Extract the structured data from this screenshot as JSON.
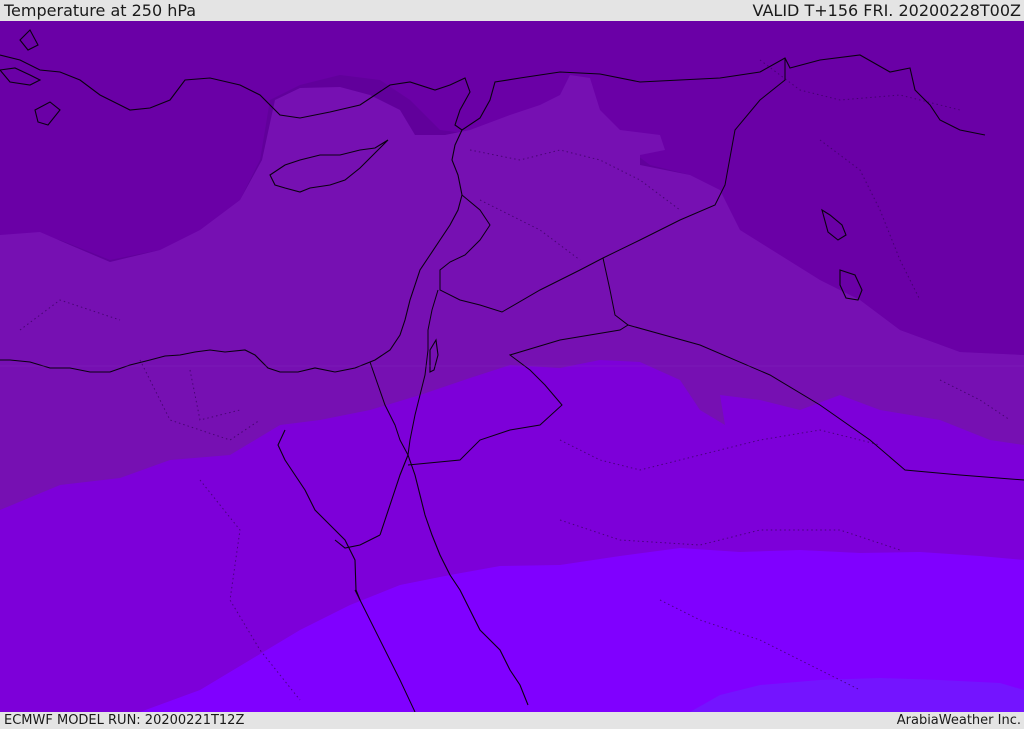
{
  "header": {
    "title": "Temperature at 250 hPa",
    "valid": "VALID T+156 FRI. 20200228T00Z"
  },
  "footer": {
    "model_run": "ECMWF MODEL RUN: 20200221T12Z",
    "credit": "ArabiaWeather Inc."
  },
  "map": {
    "variable": "Temperature at 250 hPa",
    "band_colors": [
      "#61009b",
      "#6a00a6",
      "#7610b2",
      "#7d00d9",
      "#8000ff",
      "#7414ff"
    ]
  }
}
